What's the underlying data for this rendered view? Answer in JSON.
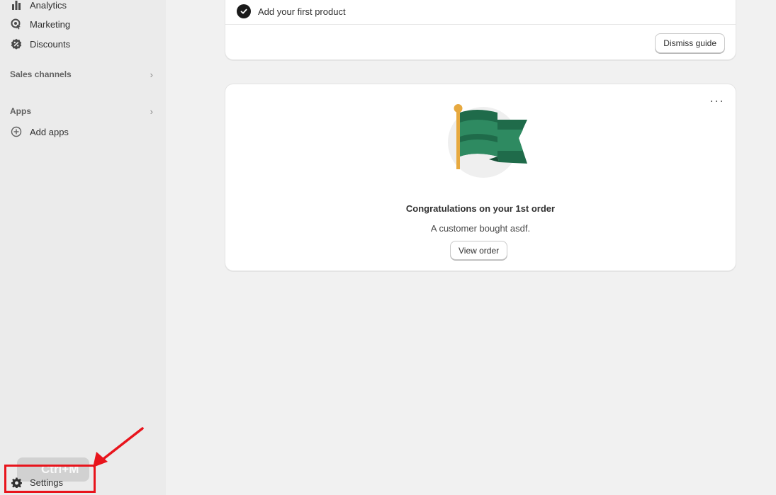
{
  "sidebar": {
    "items": [
      {
        "label": "Analytics",
        "icon": "bar-chart-icon"
      },
      {
        "label": "Marketing",
        "icon": "target-icon"
      },
      {
        "label": "Discounts",
        "icon": "discount-icon"
      }
    ],
    "sales_channels": {
      "label": "Sales channels"
    },
    "apps": {
      "label": "Apps",
      "add_label": "Add apps"
    },
    "settings": {
      "label": "Settings"
    },
    "shortcut_overlay": "Ctrl+M"
  },
  "guide_card": {
    "task_label": "Add your first product",
    "dismiss_label": "Dismiss guide"
  },
  "order_card": {
    "title": "Congratulations on your 1st order",
    "subtitle": "A customer bought asdf.",
    "view_label": "View order"
  },
  "colors": {
    "accent_green": "#1f7a55",
    "annotation_red": "#e8141c"
  }
}
